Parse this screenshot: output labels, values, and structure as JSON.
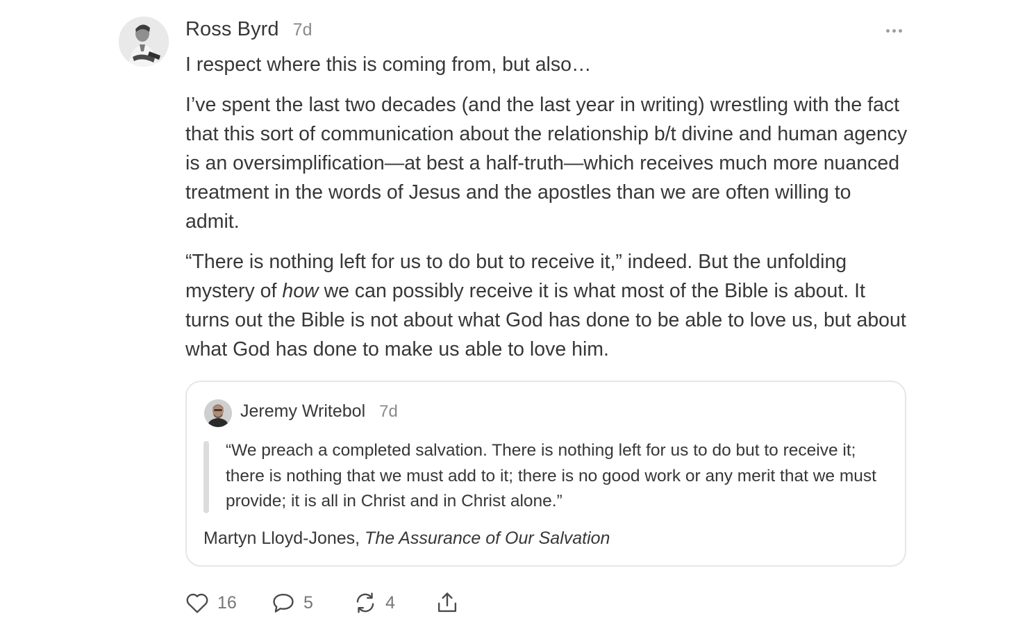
{
  "note": {
    "author": {
      "name": "Ross Byrd",
      "timestamp": "7d",
      "avatar_icon": "user-avatar-photo"
    },
    "menu_icon": "more-horizontal-icon",
    "paragraphs": {
      "p1": "I respect where this is coming from, but also…",
      "p2": "I’ve spent the last two decades (and the last year in writing) wrestling with the fact that this sort of communication about the relationship b/t divine and human agency is an oversimplification—at best a half-truth—which receives much more nuanced treatment in the words of Jesus and the apostles than we are often willing to admit.",
      "p3_before": "“There is nothing left for us to do but to receive it,” indeed. But the unfolding mystery of ",
      "p3_emphasis": "how",
      "p3_after": " we can possibly receive it is what most of the Bible is about. It turns out the Bible is not about what God has done to be able to love us, but about what God has done to make us able to love him."
    },
    "quoted_note": {
      "author": "Jeremy Writebol",
      "timestamp": "7d",
      "avatar_icon": "user-avatar-photo",
      "quote": "“We preach a completed salvation. There is nothing left for us to do but to receive it; there is nothing that we must add to it; there is no good work or any merit that we must provide; it is all in Christ and in Christ alone.”",
      "attribution_author": "Martyn Lloyd-Jones, ",
      "attribution_title": "The Assurance of Our Salvation"
    },
    "actions": {
      "likes": "16",
      "comments": "5",
      "restacks": "4",
      "icons": [
        "heart-icon",
        "comment-icon",
        "restack-icon",
        "share-icon"
      ]
    },
    "colors": {
      "text": "#363737",
      "muted": "#8a8a8a",
      "border": "#e6e6e6",
      "quote_bar": "#dcdcdc"
    }
  }
}
